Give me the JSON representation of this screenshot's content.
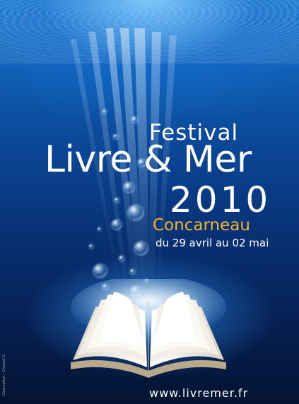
{
  "poster": {
    "festival": "Festival",
    "event_name": "Livre & Mer",
    "year": "2010",
    "city": "Concarneau",
    "dates": "du 29 avril au 02 mai",
    "website": "www.livremer.fr",
    "credit": "Conception : Chantal G."
  },
  "colors": {
    "accent_city": "#f4b52a",
    "text": "#ffffff",
    "sea_top": "#1d7fd2",
    "sea_bottom": "#041431"
  },
  "icons": [
    "open-book-illustration",
    "bubbles",
    "light-rays"
  ]
}
